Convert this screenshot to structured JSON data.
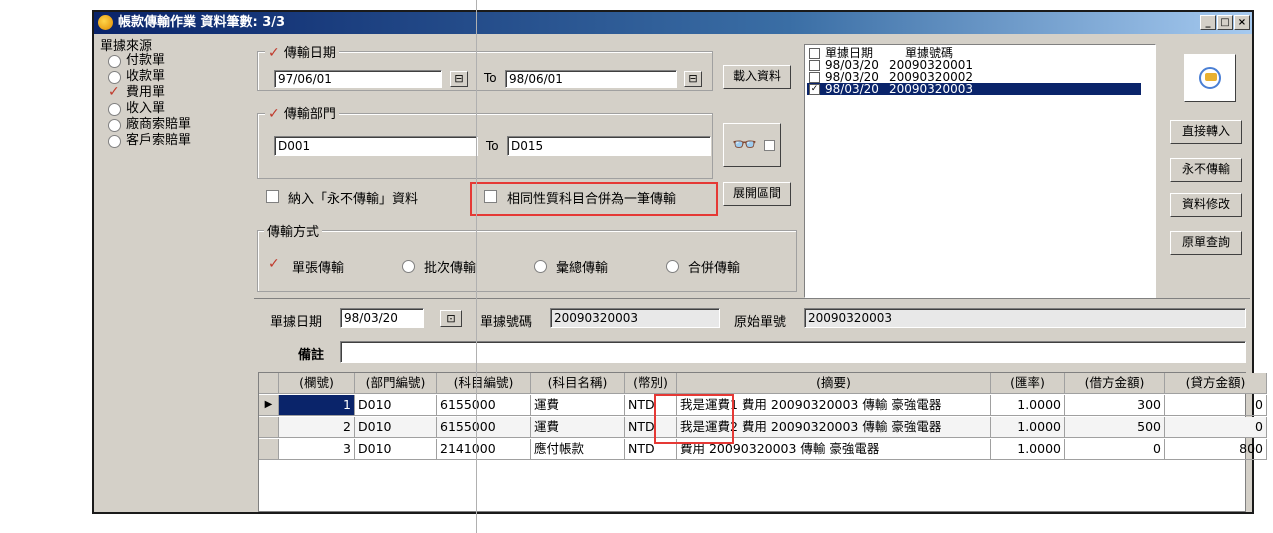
{
  "window": {
    "title": "帳款傳輸作業  資料筆數: 3/3",
    "min_label": "_",
    "max_label": "□",
    "close_label": "×"
  },
  "source": {
    "title": "單據來源",
    "options": [
      "付款單",
      "收款單",
      "費用單",
      "收入單",
      "廠商索賠單",
      "客戶索賠單"
    ],
    "selected": "費用單"
  },
  "filters": {
    "date_group": "傳輸日期",
    "date_from": "97/06/01",
    "to_label": "To",
    "date_to": "98/06/01",
    "dept_group": "傳輸部門",
    "dept_from": "D001",
    "dept_to": "D015",
    "load_button": "載入資料",
    "include_never_label": "納入「永不傳輸」資料",
    "merge_label": "相同性質科目合併為一筆傳輸",
    "expand_button": "展開區間"
  },
  "transfer": {
    "title": "傳輸方式",
    "options": [
      "單張傳輸",
      "批次傳輸",
      "彙總傳輸",
      "合併傳輸"
    ],
    "selected": "單張傳輸"
  },
  "doc_list": {
    "header_date": "單據日期",
    "header_no": "單據號碼",
    "rows": [
      {
        "date": "98/03/20",
        "no": "20090320001",
        "checked": false
      },
      {
        "date": "98/03/20",
        "no": "20090320002",
        "checked": false
      },
      {
        "date": "98/03/20",
        "no": "20090320003",
        "checked": true
      }
    ]
  },
  "actions": {
    "direct": "直接轉入",
    "never": "永不傳輸",
    "modify": "資料修改",
    "query": "原單查詢"
  },
  "detail": {
    "date_label": "單據日期",
    "date_value": "98/03/20",
    "no_label": "單據號碼",
    "no_value": "20090320003",
    "orig_label": "原始單號",
    "orig_value": "20090320003",
    "note_label": "備註",
    "note_value": ""
  },
  "grid": {
    "columns": [
      "(欄號)",
      "(部門編號)",
      "(科目編號)",
      "(科目名稱)",
      "(幣別)",
      "(摘要)",
      "(匯率)",
      "(借方金額)",
      "(貸方金額)"
    ],
    "rows": [
      [
        "1",
        "D010",
        "6155000",
        "運費",
        "NTD",
        "我是運費1 費用 20090320003 傳輸 豪強電器",
        "1.0000",
        "300",
        "0"
      ],
      [
        "2",
        "D010",
        "6155000",
        "運費",
        "NTD",
        "我是運費2 費用 20090320003 傳輸 豪強電器",
        "1.0000",
        "500",
        "0"
      ],
      [
        "3",
        "D010",
        "2141000",
        "應付帳款",
        "NTD",
        "費用 20090320003 傳輸 豪強電器",
        "1.0000",
        "0",
        "800"
      ]
    ]
  }
}
